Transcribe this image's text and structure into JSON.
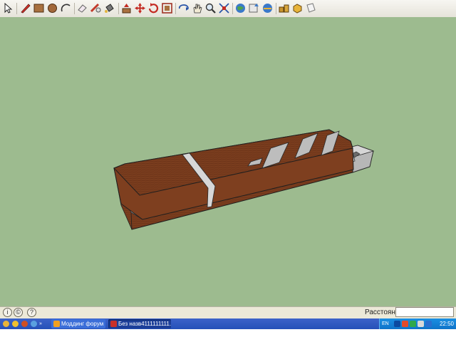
{
  "toolbar": {
    "tools": [
      "select-icon",
      "pencil-icon",
      "rectangle-icon",
      "circle-icon",
      "arc-icon",
      "eraser-icon",
      "tape-measure-icon",
      "paint-bucket-icon",
      "push-pull-icon",
      "move-icon",
      "rotate-icon",
      "offset-icon",
      "orbit-icon",
      "pan-icon",
      "zoom-icon",
      "zoom-extents-icon",
      "get-models-icon",
      "share-model-icon",
      "components-icon",
      "warehouse-icon",
      "dynamic-components-icon",
      "layout-icon"
    ]
  },
  "model": {
    "wood_color": "#7a3d1e",
    "stripe_color": "#d9d9d9"
  },
  "statusbar": {
    "help_icon": "?",
    "measurements_label": "Расстояние",
    "measurements_value": ""
  },
  "taskbar": {
    "tasks": [
      {
        "label": "Моддинг форум :: П..."
      },
      {
        "label": "Без назв4111111111..."
      }
    ],
    "language": "EN",
    "clock": "22:50"
  }
}
